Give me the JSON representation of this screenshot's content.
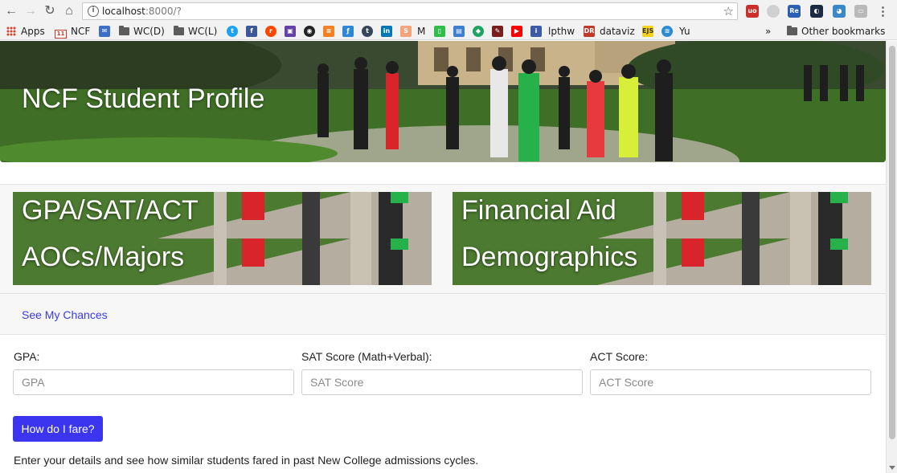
{
  "browser": {
    "url_host": "localhost",
    "url_rest": ":8000/?",
    "colors": {
      "toolbar": "#f2f2f2",
      "accent": "#3b35f0"
    }
  },
  "bookmarks": {
    "apps": "Apps",
    "ncf": "NCF",
    "ncf_badge": "11",
    "wcd": "WC(D)",
    "wcl": "WC(L)",
    "m": "M",
    "lpthw": "lpthw",
    "dataviz": "dataviz",
    "ejs": "EJS",
    "yu": "Yu",
    "overflow": "»",
    "other": "Other bookmarks"
  },
  "hero": {
    "title": "NCF Student Profile"
  },
  "cards": [
    {
      "top_label": "GPA/SAT/ACT",
      "bottom_label": "AOCs/Majors"
    },
    {
      "top_label": "Financial Aid",
      "bottom_label": "Demographics"
    }
  ],
  "nav": {
    "see_chances": "See My Chances"
  },
  "form": {
    "gpa_label": "GPA:",
    "gpa_placeholder": "GPA",
    "sat_label": "SAT Score (Math+Verbal):",
    "sat_placeholder": "SAT Score",
    "act_label": "ACT Score:",
    "act_placeholder": "ACT Score",
    "submit_label": "How do I fare?",
    "help_text": "Enter your details and see how similar students fared in past New College admissions cycles."
  }
}
